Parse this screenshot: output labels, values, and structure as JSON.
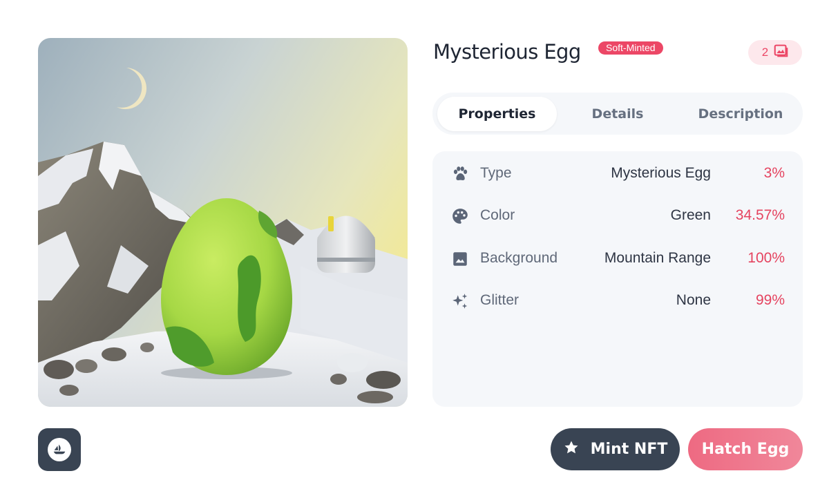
{
  "item": {
    "title": "Mysterious Egg",
    "status_badge": "Soft-Minted",
    "image_count": "2",
    "artwork_icon": "egg-mountain-artwork"
  },
  "tabs": [
    {
      "label": "Properties",
      "active": true
    },
    {
      "label": "Details",
      "active": false
    },
    {
      "label": "Description",
      "active": false
    }
  ],
  "properties": [
    {
      "icon": "paw-icon",
      "name": "Type",
      "value": "Mysterious Egg",
      "rarity": "3%"
    },
    {
      "icon": "palette-icon",
      "name": "Color",
      "value": "Green",
      "rarity": "34.57%"
    },
    {
      "icon": "image-icon",
      "name": "Background",
      "value": "Mountain Range",
      "rarity": "100%"
    },
    {
      "icon": "sparkles-icon",
      "name": "Glitter",
      "value": "None",
      "rarity": "99%"
    }
  ],
  "actions": {
    "mint_label": "Mint NFT",
    "hatch_label": "Hatch Egg",
    "marketplace_icon": "opensea-icon"
  },
  "colors": {
    "accent": "#ec4766",
    "dark": "#394453",
    "panel_bg": "#f5f7fa",
    "text_primary": "#1e2533",
    "text_secondary": "#5f6878"
  }
}
